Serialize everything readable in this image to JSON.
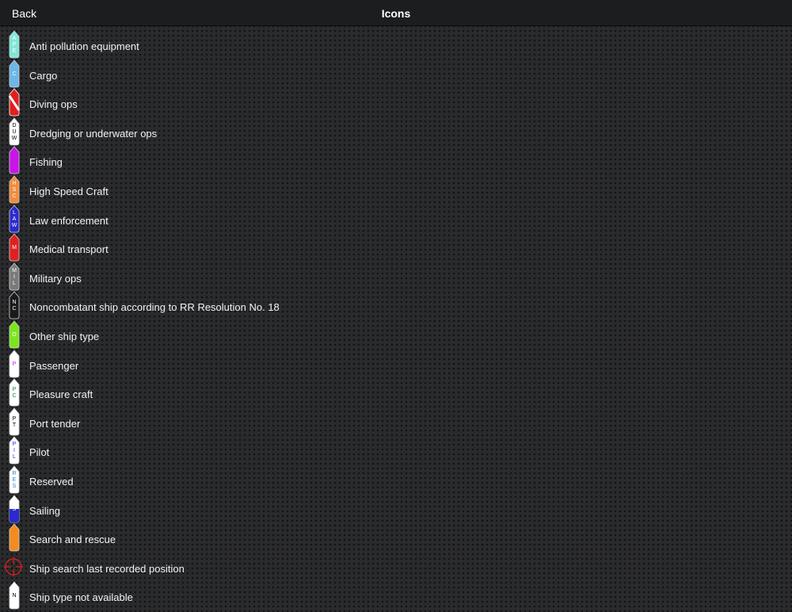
{
  "navbar": {
    "back_label": "Back",
    "title": "Icons"
  },
  "items": [
    {
      "label": "Anti pollution equipment",
      "icon": "anti-pollution-ship-icon",
      "fill": "#7fe7d8",
      "text": "#ffffff",
      "letters": "APE",
      "shape": "ship"
    },
    {
      "label": "Cargo",
      "icon": "cargo-ship-icon",
      "fill": "#6cb6e8",
      "text": "#ffffff",
      "letters": "C",
      "shape": "ship"
    },
    {
      "label": "Diving ops",
      "icon": "diving-ship-icon",
      "fill": "#e41e1e",
      "text": "#ffffff",
      "letters": "",
      "shape": "diver"
    },
    {
      "label": "Dredging or underwater ops",
      "icon": "dredging-ship-icon",
      "fill": "#ffffff",
      "text": "#000000",
      "letters": "DUW",
      "shape": "ship"
    },
    {
      "label": "Fishing",
      "icon": "fishing-ship-icon",
      "fill": "#c815e8",
      "text": "#ffffff",
      "letters": "",
      "shape": "ship"
    },
    {
      "label": "High Speed Craft",
      "icon": "high-speed-craft-ship-icon",
      "fill": "#f28c3c",
      "text": "#ffffff",
      "letters": "HSC",
      "shape": "ship"
    },
    {
      "label": "Law enforcement",
      "icon": "law-enforcement-ship-icon",
      "fill": "#2a2ad0",
      "text": "#ffffff",
      "letters": "LAW",
      "shape": "ship"
    },
    {
      "label": "Medical transport",
      "icon": "medical-transport-ship-icon",
      "fill": "#e02020",
      "text": "#ffffff",
      "letters": "M",
      "shape": "ship"
    },
    {
      "label": "Military ops",
      "icon": "military-ship-icon",
      "fill": "#7a7a7a",
      "text": "#ffffff",
      "letters": "MIL",
      "shape": "ship"
    },
    {
      "label": "Noncombatant ship according to RR Resolution No. 18",
      "icon": "noncombatant-ship-icon",
      "fill": "#1a1a1a",
      "text": "#ffffff",
      "letters": "NC",
      "shape": "ship"
    },
    {
      "label": "Other ship type",
      "icon": "other-ship-type-icon",
      "fill": "#7ae61e",
      "text": "#ffffff",
      "letters": "O",
      "shape": "ship"
    },
    {
      "label": "Passenger",
      "icon": "passenger-ship-icon",
      "fill": "#ffffff",
      "text": "#c815e8",
      "letters": "P",
      "shape": "ship"
    },
    {
      "label": "Pleasure craft",
      "icon": "pleasure-craft-ship-icon",
      "fill": "#ffffff",
      "text": "#1a7a4a",
      "letters": "PC",
      "shape": "ship"
    },
    {
      "label": "Port tender",
      "icon": "port-tender-ship-icon",
      "fill": "#ffffff",
      "text": "#000000",
      "letters": "PT",
      "shape": "ship"
    },
    {
      "label": "Pilot",
      "icon": "pilot-ship-icon",
      "fill": "#ffffff",
      "text": "#2a2ad0",
      "letters": "PIL",
      "shape": "ship"
    },
    {
      "label": "Reserved",
      "icon": "reserved-ship-icon",
      "fill": "#ffffff",
      "text": "#3a7ad0",
      "letters": "RES",
      "shape": "ship"
    },
    {
      "label": "Sailing",
      "icon": "sailing-ship-icon",
      "fill": "#2a2ad0",
      "text": "#ffffff",
      "letters": "S",
      "shape": "sail"
    },
    {
      "label": "Search and rescue",
      "icon": "search-and-rescue-ship-icon",
      "fill": "#f28c1e",
      "text": "#ffffff",
      "letters": "",
      "shape": "ship"
    },
    {
      "label": "Ship search last recorded position",
      "icon": "crosshair-icon",
      "fill": "#e02020",
      "text": "#e02020",
      "letters": "",
      "shape": "crosshair"
    },
    {
      "label": "Ship type not available",
      "icon": "ship-type-not-available-icon",
      "fill": "#ffffff",
      "text": "#000000",
      "letters": "N",
      "shape": "ship"
    }
  ]
}
